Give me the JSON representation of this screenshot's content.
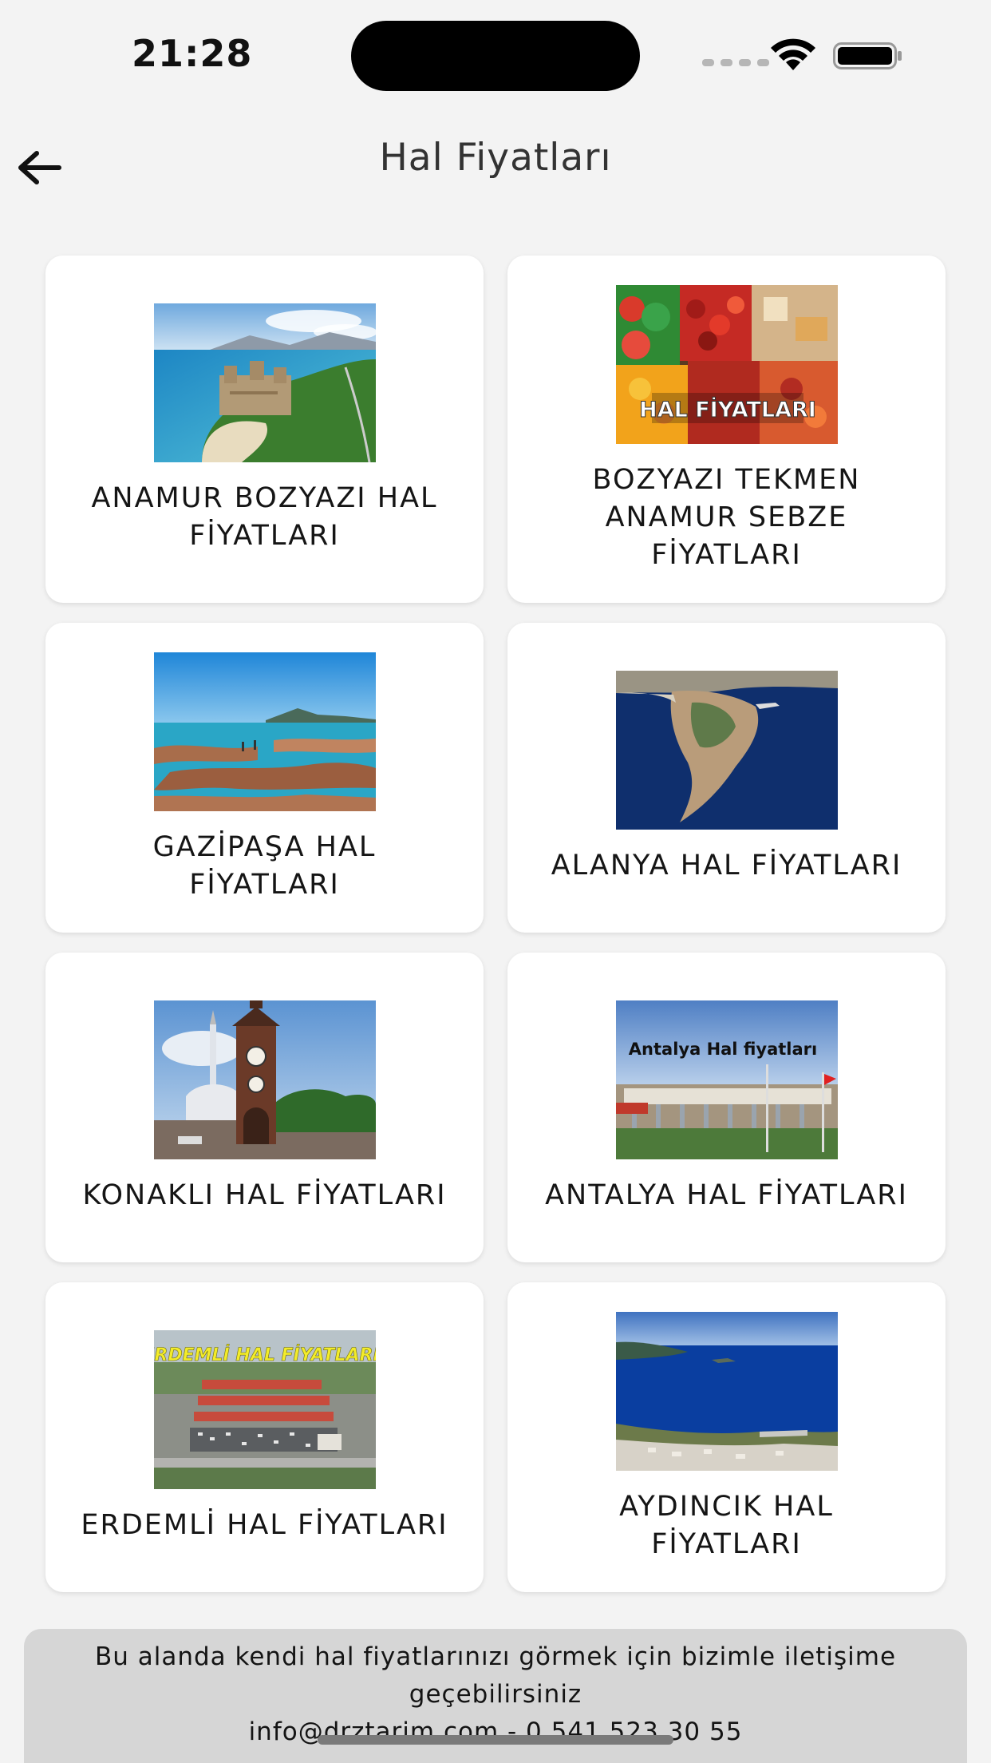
{
  "status_bar": {
    "time": "21:28"
  },
  "header": {
    "title": "Hal Fiyatları",
    "back_icon": "arrow-left-icon"
  },
  "cards": [
    {
      "label": "ANAMUR BOZYAZI HAL FİYATLARI",
      "image": "coastal-castle-image"
    },
    {
      "label": "BOZYAZI TEKMEN ANAMUR SEBZE FİYATLARI",
      "image": "market-produce-image",
      "image_text": "HAL FİYATLARI"
    },
    {
      "label": "GAZİPAŞA HAL FİYATLARI",
      "image": "rocky-shore-image"
    },
    {
      "label": "ALANYA HAL FİYATLARI",
      "image": "peninsula-aerial-image"
    },
    {
      "label": "KONAKLI HAL FİYATLARI",
      "image": "clock-tower-image"
    },
    {
      "label": "ANTALYA HAL FİYATLARI",
      "image": "market-hall-image",
      "image_text": "Antalya Hal fiyatları"
    },
    {
      "label": "ERDEMLİ HAL FİYATLARI",
      "image": "market-aerial-image",
      "image_text": "ERDEMLİ HAL FİYATLARI"
    },
    {
      "label": "AYDINCIK HAL FİYATLARI",
      "image": "bay-coast-image"
    }
  ],
  "footer": {
    "line1": "Bu alanda kendi hal fiyatlarınızı görmek için bizimle iletişime",
    "line2": "geçebilirsiniz",
    "line3": "info@drztarim.com - 0 541 523 30 55"
  }
}
